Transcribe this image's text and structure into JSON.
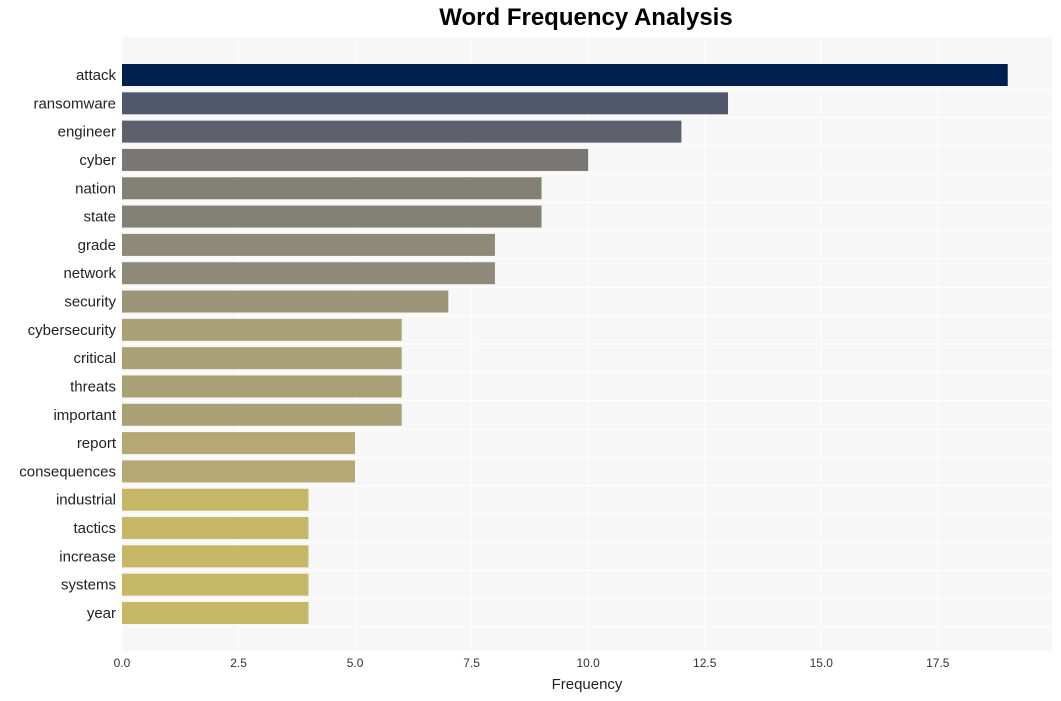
{
  "chart_data": {
    "type": "bar",
    "orientation": "horizontal",
    "title": "Word Frequency Analysis",
    "xlabel": "Frequency",
    "ylabel": "",
    "xlim": [
      0,
      19.95
    ],
    "xticks": [
      0,
      2.5,
      5,
      7.5,
      10,
      12.5,
      15,
      17.5
    ],
    "xtick_labels": [
      "0.0",
      "2.5",
      "5.0",
      "7.5",
      "10.0",
      "12.5",
      "15.0",
      "17.5"
    ],
    "grid": true,
    "categories": [
      "attack",
      "ransomware",
      "engineer",
      "cyber",
      "nation",
      "state",
      "grade",
      "network",
      "security",
      "cybersecurity",
      "critical",
      "threats",
      "important",
      "report",
      "consequences",
      "industrial",
      "tactics",
      "increase",
      "systems",
      "year"
    ],
    "values": [
      19,
      13,
      12,
      10,
      9,
      9,
      8,
      8,
      7,
      6,
      6,
      6,
      6,
      5,
      5,
      4,
      4,
      4,
      4,
      4
    ],
    "colors": [
      "#00204d",
      "#51586c",
      "#5d616e",
      "#797874",
      "#838076",
      "#838076",
      "#8f8a78",
      "#8f8a78",
      "#9c9577",
      "#aaa075",
      "#aaa075",
      "#aaa075",
      "#aaa075",
      "#b6a872",
      "#b6a872",
      "#c6b767",
      "#c6b767",
      "#c6b767",
      "#c6b767",
      "#c6b767"
    ]
  }
}
